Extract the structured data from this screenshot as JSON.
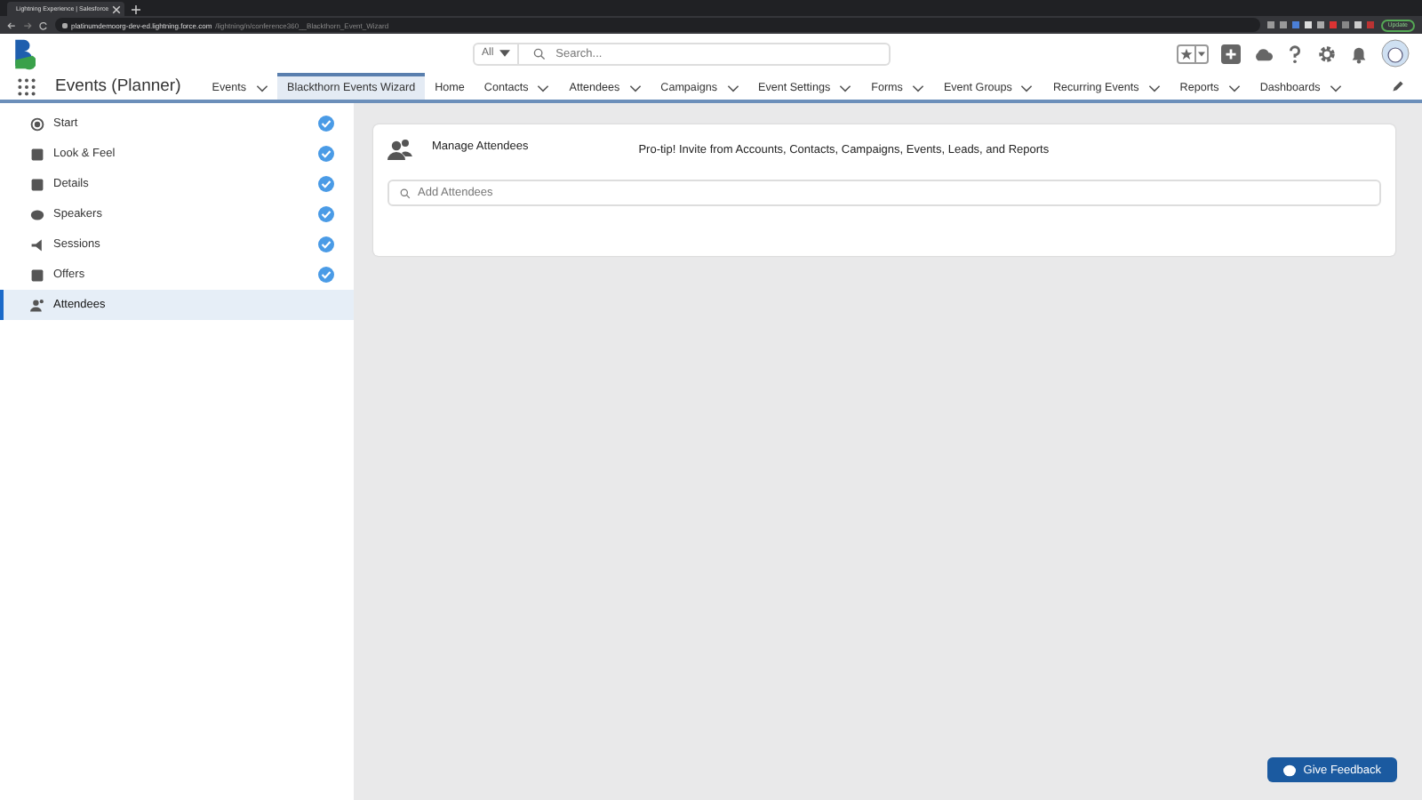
{
  "browser": {
    "tab_title": "Lightning Experience | Salesforce",
    "url_host": "platinumdemoorg-dev-ed.lightning.force.com",
    "url_path": "/lightning/n/conference360__Blackthorn_Event_Wizard",
    "update_button": "Update"
  },
  "header": {
    "search_scope": "All",
    "search_placeholder": "Search..."
  },
  "nav": {
    "app_name": "Events (Planner)",
    "items": [
      {
        "label": "Events",
        "dropdown": true,
        "selected": false
      },
      {
        "label": "Blackthorn Events Wizard",
        "dropdown": false,
        "selected": true
      },
      {
        "label": "Home",
        "dropdown": false,
        "selected": false
      },
      {
        "label": "Contacts",
        "dropdown": true,
        "selected": false
      },
      {
        "label": "Attendees",
        "dropdown": true,
        "selected": false
      },
      {
        "label": "Campaigns",
        "dropdown": true,
        "selected": false
      },
      {
        "label": "Event Settings",
        "dropdown": true,
        "selected": false
      },
      {
        "label": "Forms",
        "dropdown": true,
        "selected": false
      },
      {
        "label": "Event Groups",
        "dropdown": true,
        "selected": false
      },
      {
        "label": "Recurring Events",
        "dropdown": true,
        "selected": false
      },
      {
        "label": "Reports",
        "dropdown": true,
        "selected": false
      },
      {
        "label": "Dashboards",
        "dropdown": true,
        "selected": false
      }
    ]
  },
  "steps": [
    {
      "label": "Start",
      "completed": true,
      "selected": false
    },
    {
      "label": "Look & Feel",
      "completed": true,
      "selected": false
    },
    {
      "label": "Details",
      "completed": true,
      "selected": false
    },
    {
      "label": "Speakers",
      "completed": true,
      "selected": false
    },
    {
      "label": "Sessions",
      "completed": true,
      "selected": false
    },
    {
      "label": "Offers",
      "completed": true,
      "selected": false
    },
    {
      "label": "Attendees",
      "completed": false,
      "selected": true
    }
  ],
  "card": {
    "title": "Manage Attendees",
    "tip": "Pro-tip! Invite from Accounts, Contacts, Campaigns, Events, Leads, and Reports",
    "search_placeholder": "Add Attendees"
  },
  "feedback_button": "Give Feedback"
}
